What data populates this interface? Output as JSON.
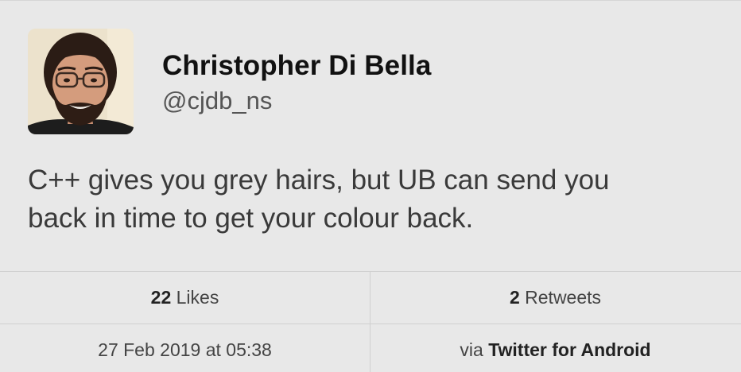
{
  "author": {
    "display_name": "Christopher Di Bella",
    "handle": "@cjdb_ns",
    "avatar_icon": "profile-photo"
  },
  "tweet": {
    "text_line1": "C++ gives you grey hairs, but UB can send you",
    "text_line2": "back in time to get your colour back."
  },
  "stats": {
    "likes_count": "22",
    "likes_label": "Likes",
    "retweets_count": "2",
    "retweets_label": "Retweets"
  },
  "meta": {
    "timestamp": "27 Feb 2019 at 05:38",
    "via_prefix": "via",
    "source": "Twitter for Android"
  },
  "colors": {
    "background": "#e8e8e8",
    "divider": "#cfcfcf",
    "name_text": "#111111",
    "body_text": "#3a3a3a"
  }
}
